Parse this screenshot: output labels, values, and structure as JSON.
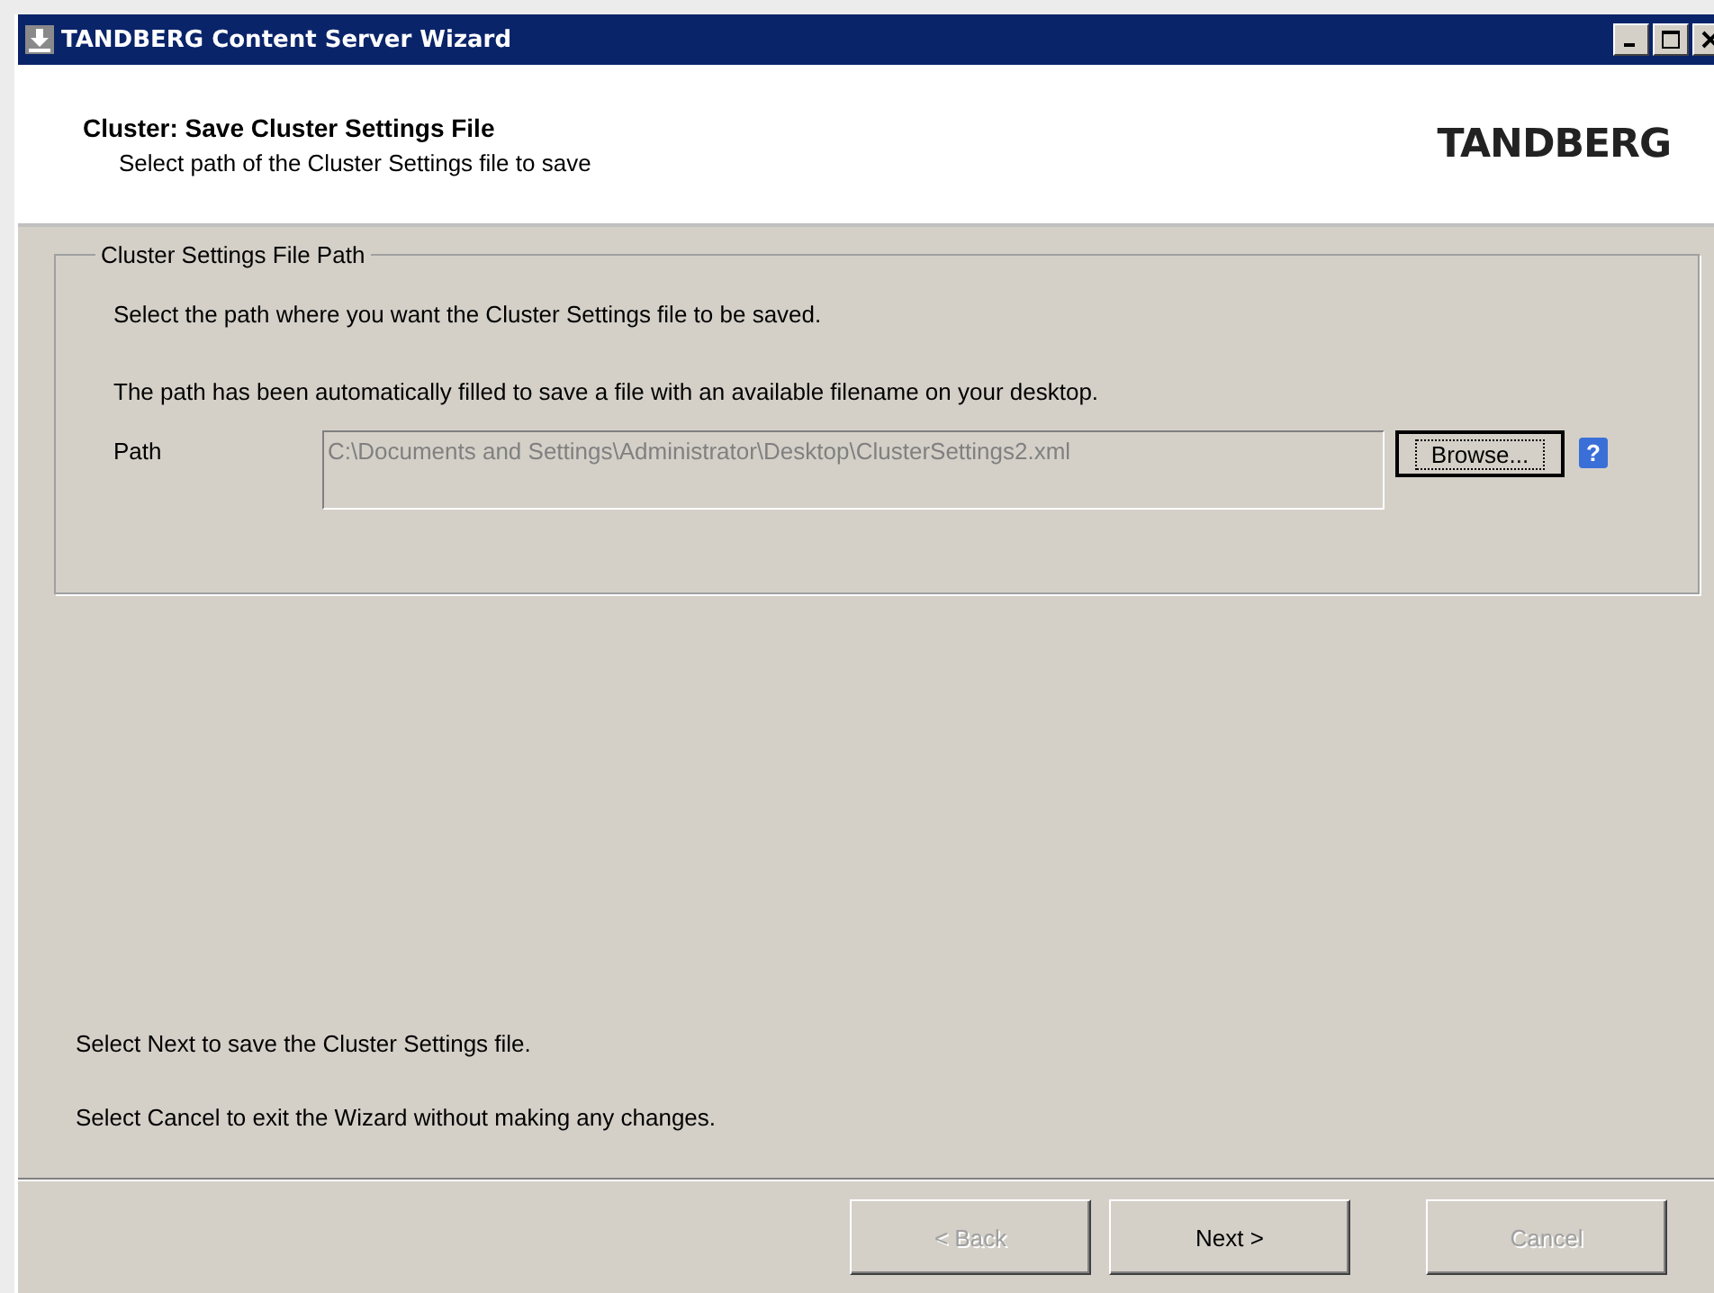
{
  "window": {
    "title": "TANDBERG Content Server Wizard"
  },
  "header": {
    "title": "Cluster: Save Cluster Settings File",
    "subtitle": "Select path of the Cluster Settings file to save",
    "logo": "TANDBERG"
  },
  "group": {
    "legend": "Cluster Settings File Path",
    "instruction": "Select the path where you want the Cluster Settings file to be saved.",
    "note": "The path has been automatically filled to save a file with an available filename on your desktop.",
    "path_label": "Path",
    "path_value": "C:\\Documents and Settings\\Administrator\\Desktop\\ClusterSettings2.xml",
    "path_disabled": true,
    "browse": "Browse...",
    "help": "?"
  },
  "footer_notes": [
    "Select Next to save the Cluster Settings file.",
    "Select Cancel to exit the Wizard without making any changes."
  ],
  "buttons": [
    {
      "label": "< Back",
      "disabled": true
    },
    {
      "label": "Next >",
      "disabled": false
    },
    {
      "label": "Cancel",
      "disabled": true
    }
  ]
}
